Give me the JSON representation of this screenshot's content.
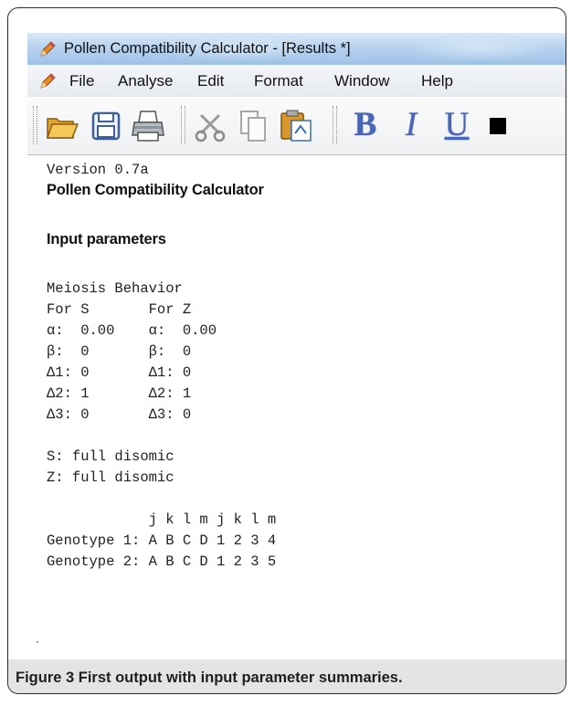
{
  "window": {
    "title": "Pollen Compatibility Calculator - [Results *]",
    "icon": "pencil-app-icon"
  },
  "menu": {
    "items": [
      "File",
      "Analyse",
      "Edit",
      "Format",
      "Window",
      "Help"
    ]
  },
  "toolbar": {
    "buttons": [
      "open-folder-icon",
      "save-disk-icon",
      "print-icon",
      "cut-icon",
      "copy-icon",
      "paste-icon"
    ],
    "format_bold": "B",
    "format_italic": "I",
    "format_underline": "U",
    "color_swatch": "#000000"
  },
  "results": {
    "version": "Version 0.7a",
    "heading": "Pollen Compatibility Calculator",
    "section": "Input parameters",
    "meiosis_title": "Meiosis Behavior",
    "meiosis_header": "For S       For Z",
    "rows": [
      "α:  0.00    α:  0.00",
      "β:  0       β:  0",
      "Δ1: 0       Δ1: 0",
      "Δ2: 1       Δ2: 1",
      "Δ3: 0       Δ3: 0"
    ],
    "s_mode": "S: full disomic",
    "z_mode": "Z: full disomic",
    "genotype_header": "            j k l m j k l m",
    "genotypes": [
      "Genotype 1: A B C D 1 2 3 4",
      "Genotype 2: A B C D 1 2 3 5"
    ]
  },
  "caption": {
    "bold": "Figure 3 First output with input parameter summaries."
  }
}
